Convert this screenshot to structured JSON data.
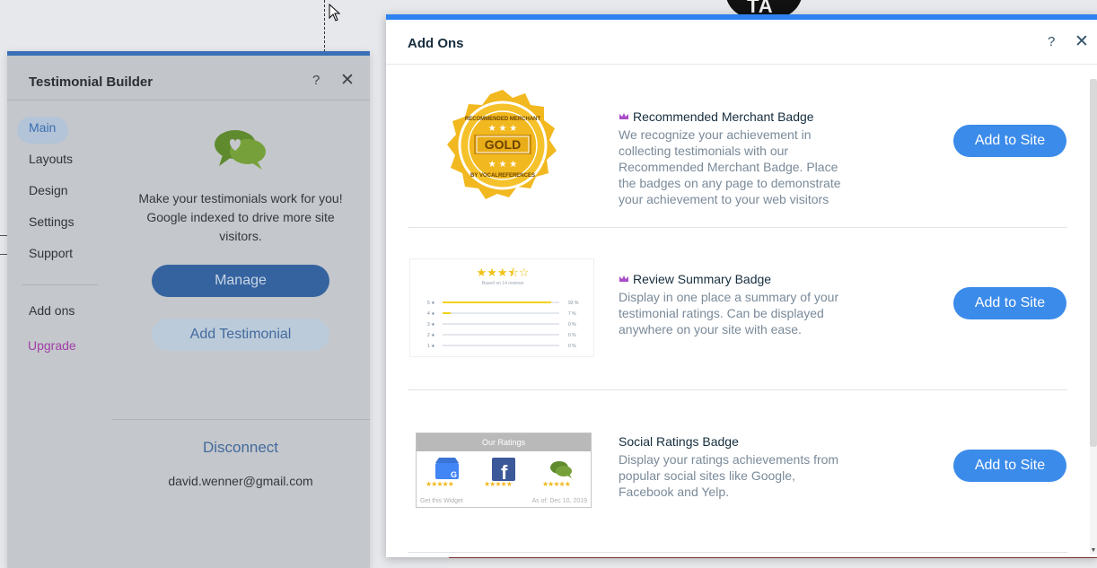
{
  "background": {
    "logo_text": "TA"
  },
  "testimonial_builder": {
    "title": "Testimonial Builder",
    "help_icon": "question-icon",
    "close_icon": "close-icon",
    "nav": {
      "main": "Main",
      "layouts": "Layouts",
      "design": "Design",
      "settings": "Settings",
      "support": "Support",
      "add_ons": "Add ons",
      "upgrade": "Upgrade"
    },
    "description": "Make your testimonials work for you! Google indexed to drive more site visitors.",
    "manage_label": "Manage",
    "add_testimonial_label": "Add Testimonial",
    "disconnect_label": "Disconnect",
    "email": "david.wenner@gmail.com",
    "accent_color": "#3a70b8"
  },
  "add_ons": {
    "title": "Add Ons",
    "help_icon": "question-icon",
    "close_icon": "close-icon",
    "accent_color": "#2d82f0",
    "items": [
      {
        "name": "Recommended Merchant Badge",
        "premium": true,
        "description": "We recognize your achievement in collecting testimonials with our Recommended Merchant Badge. Place the badges on any page to demonstrate your achievement to your web visitors",
        "button": "Add to Site",
        "badge_top_text": "RECOMMENDED MERCHANT",
        "badge_center_text": "GOLD",
        "badge_bottom_text": "BY VOCALREFERENCES"
      },
      {
        "name": "Review Summary Badge",
        "premium": true,
        "description": "Display in one place a summary of your testimonial ratings. Can be displayed anywhere on your site with ease.",
        "button": "Add to Site",
        "preview_rating_stars": 3.5,
        "preview_subtitle": "Based on 14 reviews",
        "preview_rows": [
          {
            "star": "5",
            "pct": "93 %",
            "fill": 0.93
          },
          {
            "star": "4",
            "pct": "7 %",
            "fill": 0.07
          },
          {
            "star": "3",
            "pct": "0 %",
            "fill": 0
          },
          {
            "star": "2",
            "pct": "0 %",
            "fill": 0
          },
          {
            "star": "1",
            "pct": "0 %",
            "fill": 0
          }
        ]
      },
      {
        "name": "Social Ratings Badge",
        "premium": false,
        "description": "Display your ratings achievements from popular social sites like Google, Facebook and Yelp.",
        "button": "Add to Site",
        "preview_title": "Our Ratings",
        "preview_footer_left": "Get this Widget",
        "preview_footer_right": "As of: Dec 10, 2019",
        "preview_sites": [
          "google-my-business-icon",
          "facebook-icon",
          "chat-bubble-icon"
        ]
      }
    ]
  }
}
